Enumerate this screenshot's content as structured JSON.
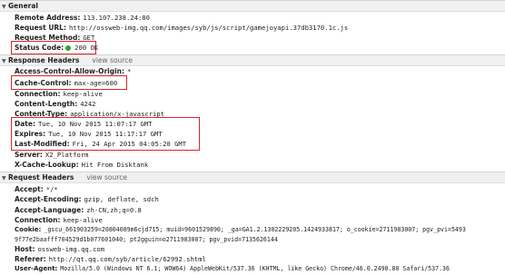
{
  "general": {
    "title": "General",
    "rows": [
      {
        "k": "Remote Address:",
        "v": "113.107.238.24:80"
      },
      {
        "k": "Request URL:",
        "v": "http://ossweb-img.qq.com/images/syb/js/script/gamejoyapi.37db3170.1c.js"
      },
      {
        "k": "Request Method:",
        "v": "GET"
      },
      {
        "k": "Status Code:",
        "v": "200 OK"
      }
    ]
  },
  "response": {
    "title": "Response Headers",
    "view_source": "view source",
    "rows": [
      {
        "k": "Access-Control-Allow-Origin:",
        "v": "*"
      },
      {
        "k": "Cache-Control:",
        "v": "max-age=600"
      },
      {
        "k": "Connection:",
        "v": "keep-alive"
      },
      {
        "k": "Content-Length:",
        "v": "4242"
      },
      {
        "k": "Content-Type:",
        "v": "application/x-javascript"
      },
      {
        "k": "Date:",
        "v": "Tue, 10 Nov 2015 11:07:17 GMT"
      },
      {
        "k": "Expires:",
        "v": "Tue, 10 Nov 2015 11:17:17 GMT"
      },
      {
        "k": "Last-Modified:",
        "v": "Fri, 24 Apr 2015 04:05:20 GMT"
      },
      {
        "k": "Server:",
        "v": "X2_Platform"
      },
      {
        "k": "X-Cache-Lookup:",
        "v": "Hit From Disktank"
      }
    ]
  },
  "request": {
    "title": "Request Headers",
    "view_source": "view source",
    "rows": [
      {
        "k": "Accept:",
        "v": "*/*"
      },
      {
        "k": "Accept-Encoding:",
        "v": "gzip, deflate, sdch"
      },
      {
        "k": "Accept-Language:",
        "v": "zh-CN,zh;q=0.8"
      },
      {
        "k": "Connection:",
        "v": "keep-alive"
      },
      {
        "k": "Cookie:",
        "v": "_gscu_661903259=20804089m6cjd715; muid=9601529890; _ga=GA1.2.1302229205.1424933817; o_cookie=2711983007; pgv_pvi=5493"
      },
      {
        "k": "",
        "v": "9f77e2baafff704529d1b077601040; pt2gguin=o2711983007; pgv_pvid=7135626144"
      },
      {
        "k": "Host:",
        "v": "ossweb-img.qq.com"
      },
      {
        "k": "Referer:",
        "v": "http://qt.qq.com/syb/article/62992.shtml"
      },
      {
        "k": "User-Agent:",
        "v": "Mozilla/5.0 (Windows NT 6.1; WOW64) AppleWebKit/537.36 (KHTML, like Gecko) Chrome/46.0.2490.80 Safari/537.36"
      }
    ]
  },
  "colors": {
    "highlight": "#d9262b",
    "status_ok": "#1fae1f"
  },
  "icons": {
    "expanded": "triangle-down-icon",
    "status": "green-dot-icon"
  }
}
